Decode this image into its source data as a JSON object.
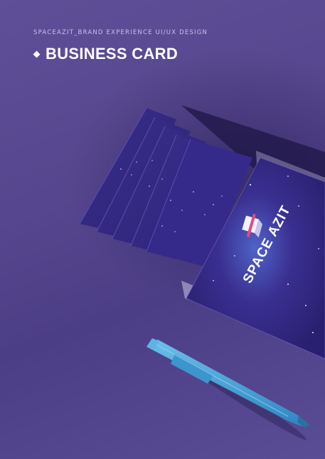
{
  "header": {
    "subtitle": "SPACEAZIT_BRAND EXPERIENCE UI/UX DESIGN",
    "title": "BUSINESS CARD"
  },
  "card": {
    "logo_text": "SPACE AZIT"
  },
  "colors": {
    "background": "#56468f",
    "card": "#3a2f8a",
    "pen": "#4aa6d8"
  }
}
